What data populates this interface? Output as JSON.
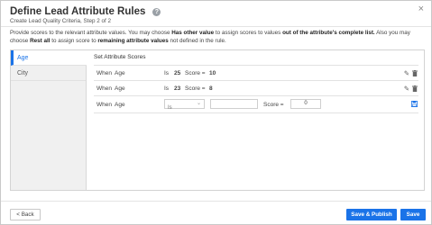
{
  "header": {
    "title": "Define Lead Attribute Rules",
    "subtitle": "Create Lead Quality Criteria, Step 2 of 2",
    "help_icon": "?",
    "close_icon": "×"
  },
  "description": {
    "part1": "Provide scores to the relevant attribute values. You may choose ",
    "bold1": "Has other value",
    "part2": " to assign scores to values ",
    "bold2": "out of the attribute's complete list.",
    "part3": " Also you may choose ",
    "bold3": "Rest all",
    "part4": " to assign score to ",
    "bold4": "remaining attribute values",
    "part5": " not defined in the rule."
  },
  "sidebar": {
    "items": [
      {
        "label": "Age"
      },
      {
        "label": "City"
      }
    ]
  },
  "content": {
    "title": "Set Attribute Scores",
    "rules": [
      {
        "when": "When",
        "attribute": "Age",
        "operator": "Is",
        "value": "25",
        "score_label": "Score =",
        "score": "10"
      },
      {
        "when": "When",
        "attribute": "Age",
        "operator": "Is",
        "value": "23",
        "score_label": "Score =",
        "score": "8"
      }
    ],
    "new_rule": {
      "when": "When",
      "attribute": "Age",
      "operator_selected": "Is",
      "value_placeholder": "",
      "score_label": "Score =",
      "score_value": "0"
    }
  },
  "footer": {
    "back_label": "< Back",
    "save_publish_label": "Save & Publish",
    "save_label": "Save"
  },
  "colors": {
    "accent": "#1a73e8",
    "sidebar_bg": "#f0f0f0"
  }
}
